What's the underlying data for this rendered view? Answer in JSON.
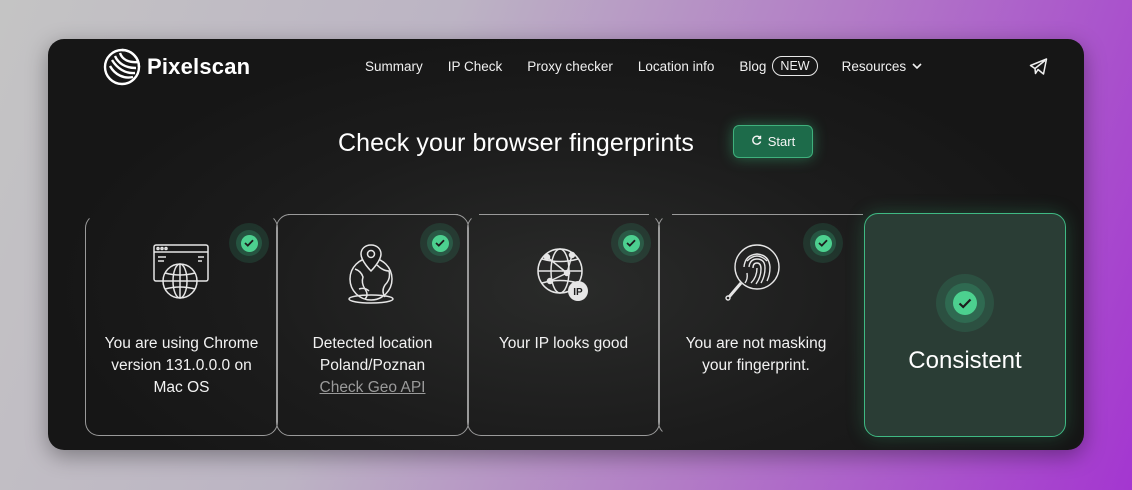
{
  "brand": {
    "name": "Pixelscan"
  },
  "nav": {
    "items": [
      "Summary",
      "IP Check",
      "Proxy checker",
      "Location info"
    ],
    "blog_label": "Blog",
    "blog_badge": "NEW",
    "resources_label": "Resources"
  },
  "hero": {
    "title": "Check your browser fingerprints",
    "start_label": "Start"
  },
  "cards": [
    {
      "icon": "browser-globe-icon",
      "lines": [
        "You are using Chrome",
        "version 131.0.0.0 on",
        "Mac OS"
      ]
    },
    {
      "icon": "location-globe-icon",
      "lines": [
        "Detected location",
        "Poland/Poznan"
      ],
      "link": "Check Geo API"
    },
    {
      "icon": "ip-globe-icon",
      "lines": [
        "Your IP looks good"
      ]
    },
    {
      "icon": "fingerprint-magnifier-icon",
      "lines": [
        "You are not masking",
        "your fingerprint."
      ]
    }
  ],
  "result": {
    "label": "Consistent"
  },
  "colors": {
    "accent": "#4cd08f",
    "button": "#1d6b4a",
    "final_bg": "#2a3d35"
  }
}
